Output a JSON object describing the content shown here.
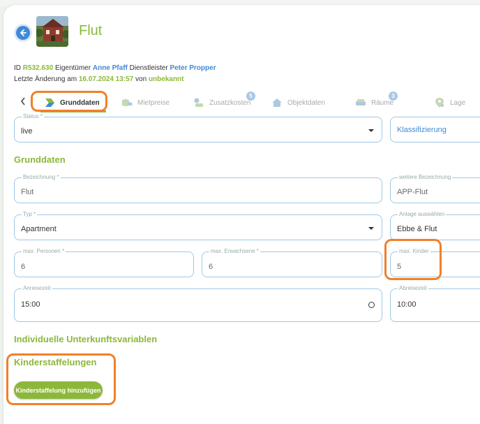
{
  "header": {
    "title": "Flut",
    "id_label": "ID",
    "id_value": "R532.630",
    "owner_label": "Eigentümer",
    "owner_value": "Anne Pfaff",
    "provider_label": "Dienstleister",
    "provider_value": "Peter Propper",
    "last_change_label": "Letzte Änderung am",
    "last_change_value": "16.07.2024 13:57",
    "by_label": "von",
    "by_value": "unbekannt"
  },
  "tabs": [
    {
      "label": "Grunddaten",
      "icon": "arrow-chevron-icon",
      "badge": ""
    },
    {
      "label": "Mietpreise",
      "icon": "coins-icon",
      "badge": ""
    },
    {
      "label": "Zusatzkosten",
      "icon": "cost-icon",
      "badge": "5"
    },
    {
      "label": "Objektdaten",
      "icon": "house-icon",
      "badge": ""
    },
    {
      "label": "Räume",
      "icon": "sofa-icon",
      "badge": "3"
    },
    {
      "label": "Lage",
      "icon": "map-pin-icon",
      "badge": ""
    }
  ],
  "fields": {
    "status": {
      "label": "Status *",
      "value": "live"
    },
    "klassifizierung": {
      "placeholder": "Klassifizierung"
    },
    "bezeichnung": {
      "label": "Bezeichnung *",
      "value": "Flut"
    },
    "weitere_bezeichnung": {
      "label": "weitere Bezeichnung",
      "value": "APP-Flut"
    },
    "typ": {
      "label": "Typ *",
      "value": "Apartment"
    },
    "anlage": {
      "label": "Anlage auswählen",
      "value": "Ebbe & Flut"
    },
    "max_personen": {
      "label": "max. Personen *",
      "value": "6"
    },
    "max_erwachsene": {
      "label": "max. Erwachsene *",
      "value": "6"
    },
    "max_kinder": {
      "label": "max. Kinder",
      "value": "5"
    },
    "anreisezeit": {
      "label": "Anreisezeit",
      "value": "15:00"
    },
    "abreisezeit": {
      "label": "Abreisezeit",
      "value": "10:00"
    }
  },
  "sections": {
    "grunddaten": "Grunddaten",
    "individuelle": "Individuelle Unterkunftsvariablen",
    "kinderstaffelungen": "Kinderstaffelungen"
  },
  "buttons": {
    "add_kinderstaffelung": "Kinderstaffelung hinzufügen"
  },
  "colors": {
    "accent_green": "#8cb83a",
    "accent_blue": "#3f8ad6",
    "highlight_orange": "#f0802a"
  }
}
